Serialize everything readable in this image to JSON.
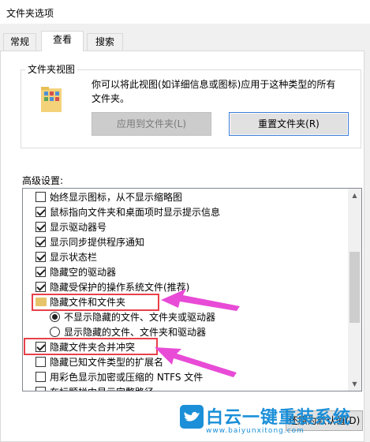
{
  "window": {
    "title": "文件夹选项"
  },
  "tabs": [
    {
      "label": "常规",
      "active": false
    },
    {
      "label": "查看",
      "active": true
    },
    {
      "label": "搜索",
      "active": false
    }
  ],
  "folder_view": {
    "group_label": "文件夹视图",
    "description_line1": "你可以将此视图(如详细信息或图标)应用于这种类型的所有",
    "description_line2": "文件夹。",
    "apply_button": "应用到文件夹(L)",
    "reset_button": "重置文件夹(R)"
  },
  "advanced": {
    "label": "高级设置:",
    "items": [
      {
        "type": "checkbox",
        "checked": false,
        "label": "始终显示图标，从不显示缩略图"
      },
      {
        "type": "checkbox",
        "checked": true,
        "label": "鼠标指向文件夹和桌面项时显示提示信息"
      },
      {
        "type": "checkbox",
        "checked": true,
        "label": "显示驱动器号"
      },
      {
        "type": "checkbox",
        "checked": true,
        "label": "显示同步提供程序通知"
      },
      {
        "type": "checkbox",
        "checked": true,
        "label": "显示状态栏"
      },
      {
        "type": "checkbox",
        "checked": true,
        "label": "隐藏空的驱动器"
      },
      {
        "type": "checkbox",
        "checked": true,
        "label": "隐藏受保护的操作系统文件(推荐)"
      },
      {
        "type": "folder",
        "label": "隐藏文件和文件夹"
      },
      {
        "type": "radio",
        "checked": true,
        "label": "不显示隐藏的文件、文件夹或驱动器"
      },
      {
        "type": "radio",
        "checked": false,
        "label": "显示隐藏的文件、文件夹和驱动器"
      },
      {
        "type": "checkbox",
        "checked": true,
        "label": "隐藏文件夹合并冲突"
      },
      {
        "type": "checkbox",
        "checked": false,
        "label": "隐藏已知文件类型的扩展名"
      },
      {
        "type": "checkbox",
        "checked": false,
        "label": "用彩色显示加密或压缩的 NTFS 文件"
      },
      {
        "type": "checkbox",
        "checked": false,
        "label": "在标题栏中显示完整路径"
      }
    ]
  },
  "restore_default_button": "还原为默认值(D)",
  "watermark": {
    "text": "白云一键重装系统",
    "url": "www.baiyunxitong.com"
  },
  "colors": {
    "highlight": "#e8404a",
    "arrow": "#e84bd6",
    "brand": "#1b8fd8"
  }
}
